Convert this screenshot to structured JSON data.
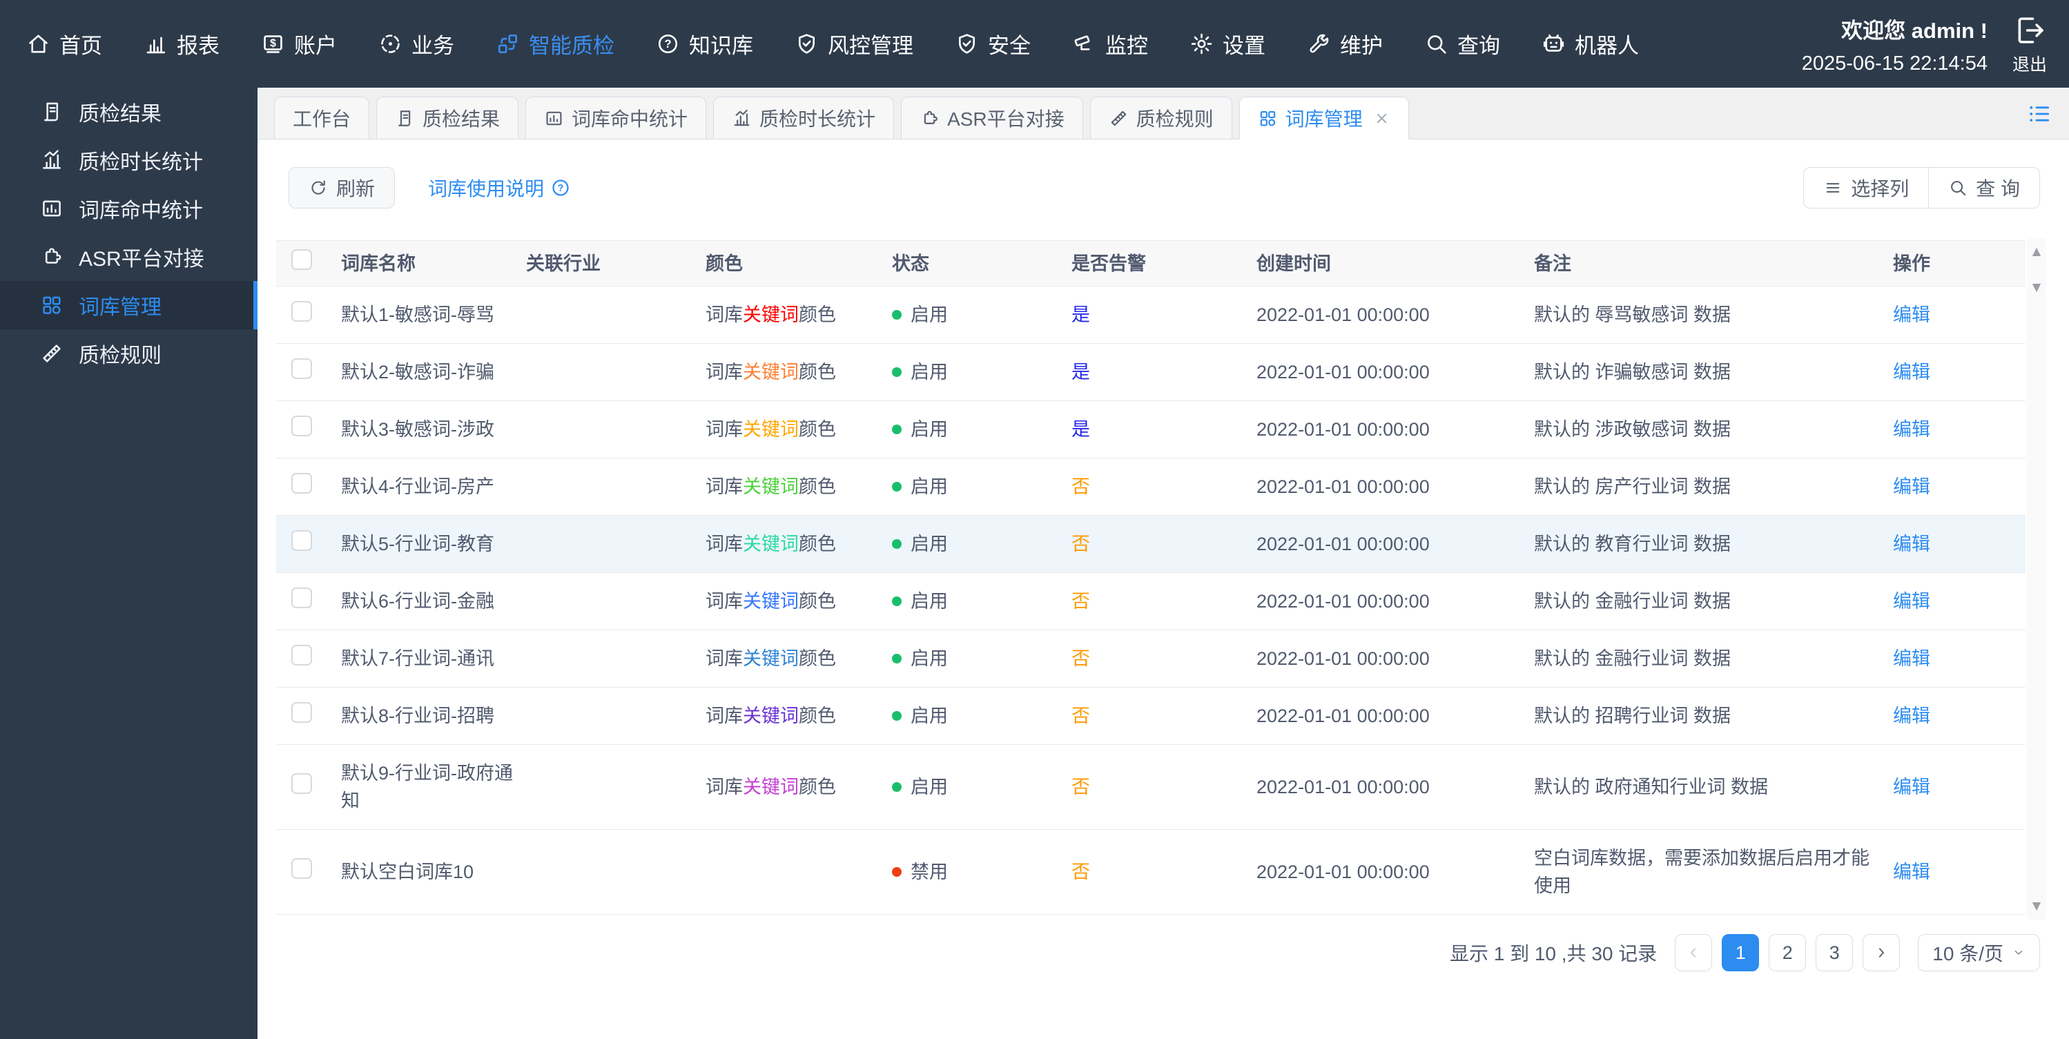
{
  "topnav": {
    "items": [
      {
        "label": "首页",
        "icon": "home"
      },
      {
        "label": "报表",
        "icon": "report"
      },
      {
        "label": "账户",
        "icon": "account"
      },
      {
        "label": "业务",
        "icon": "business"
      },
      {
        "label": "智能质检",
        "icon": "quality-check"
      },
      {
        "label": "知识库",
        "icon": "knowledge"
      },
      {
        "label": "风控管理",
        "icon": "risk-control"
      },
      {
        "label": "安全",
        "icon": "security"
      },
      {
        "label": "监控",
        "icon": "monitor"
      },
      {
        "label": "设置",
        "icon": "settings"
      },
      {
        "label": "维护",
        "icon": "maintenance"
      },
      {
        "label": "查询",
        "icon": "query"
      },
      {
        "label": "机器人",
        "icon": "robot"
      }
    ],
    "welcome": "欢迎您 admin !",
    "datetime": "2025-06-15 22:14:54",
    "logout": "退出"
  },
  "sidebar": {
    "items": [
      {
        "label": "质检结果"
      },
      {
        "label": "质检时长统计"
      },
      {
        "label": "词库命中统计"
      },
      {
        "label": "ASR平台对接"
      },
      {
        "label": "词库管理"
      },
      {
        "label": "质检规则"
      }
    ]
  },
  "tabs": {
    "items": [
      {
        "label": "工作台"
      },
      {
        "label": "质检结果"
      },
      {
        "label": "词库命中统计"
      },
      {
        "label": "质检时长统计"
      },
      {
        "label": "ASR平台对接"
      },
      {
        "label": "质检规则"
      },
      {
        "label": "词库管理"
      }
    ]
  },
  "toolbar": {
    "refresh": "刷新",
    "help": "词库使用说明",
    "columns": "选择列",
    "query": "查 询"
  },
  "table": {
    "headers": [
      "词库名称",
      "关联行业",
      "颜色",
      "状态",
      "是否告警",
      "创建时间",
      "备注",
      "操作"
    ],
    "rows": [
      {
        "name": "默认1-敏感词-辱骂",
        "industry": "",
        "color_pre": "词库",
        "color_word": "关键词",
        "color_post": "颜色",
        "color_hex": "#ff0000",
        "status": "启用",
        "status_color": "#19be6b",
        "alarm": "是",
        "alarm_color": "#2727ee",
        "created": "2022-01-01 00:00:00",
        "remark": "默认的 辱骂敏感词 数据",
        "action": "编辑"
      },
      {
        "name": "默认2-敏感词-诈骗",
        "industry": "",
        "color_pre": "词库",
        "color_word": "关键词",
        "color_post": "颜色",
        "color_hex": "#ff7f33",
        "status": "启用",
        "status_color": "#19be6b",
        "alarm": "是",
        "alarm_color": "#2727ee",
        "created": "2022-01-01 00:00:00",
        "remark": "默认的 诈骗敏感词 数据",
        "action": "编辑"
      },
      {
        "name": "默认3-敏感词-涉政",
        "industry": "",
        "color_pre": "词库",
        "color_word": "关键词",
        "color_post": "颜色",
        "color_hex": "#ffa500",
        "status": "启用",
        "status_color": "#19be6b",
        "alarm": "是",
        "alarm_color": "#2727ee",
        "created": "2022-01-01 00:00:00",
        "remark": "默认的 涉政敏感词 数据",
        "action": "编辑"
      },
      {
        "name": "默认4-行业词-房产",
        "industry": "",
        "color_pre": "词库",
        "color_word": "关键词",
        "color_post": "颜色",
        "color_hex": "#4bd139",
        "status": "启用",
        "status_color": "#19be6b",
        "alarm": "否",
        "alarm_color": "#ff9900",
        "created": "2022-01-01 00:00:00",
        "remark": "默认的 房产行业词 数据",
        "action": "编辑"
      },
      {
        "name": "默认5-行业词-教育",
        "industry": "",
        "color_pre": "词库",
        "color_word": "关键词",
        "color_post": "颜色",
        "color_hex": "#2bd9a5",
        "status": "启用",
        "status_color": "#19be6b",
        "alarm": "否",
        "alarm_color": "#ff9900",
        "created": "2022-01-01 00:00:00",
        "remark": "默认的 教育行业词 数据",
        "action": "编辑"
      },
      {
        "name": "默认6-行业词-金融",
        "industry": "",
        "color_pre": "词库",
        "color_word": "关键词",
        "color_post": "颜色",
        "color_hex": "#3377fc",
        "status": "启用",
        "status_color": "#19be6b",
        "alarm": "否",
        "alarm_color": "#ff9900",
        "created": "2022-01-01 00:00:00",
        "remark": "默认的 金融行业词 数据",
        "action": "编辑"
      },
      {
        "name": "默认7-行业词-通讯",
        "industry": "",
        "color_pre": "词库",
        "color_word": "关键词",
        "color_post": "颜色",
        "color_hex": "#2e82d4",
        "status": "启用",
        "status_color": "#19be6b",
        "alarm": "否",
        "alarm_color": "#ff9900",
        "created": "2022-01-01 00:00:00",
        "remark": "默认的 金融行业词 数据",
        "action": "编辑"
      },
      {
        "name": "默认8-行业词-招聘",
        "industry": "",
        "color_pre": "词库",
        "color_word": "关键词",
        "color_post": "颜色",
        "color_hex": "#6a32d3",
        "status": "启用",
        "status_color": "#19be6b",
        "alarm": "否",
        "alarm_color": "#ff9900",
        "created": "2022-01-01 00:00:00",
        "remark": "默认的 招聘行业词 数据",
        "action": "编辑"
      },
      {
        "name": "默认9-行业词-政府通知",
        "industry": "",
        "color_pre": "词库",
        "color_word": "关键词",
        "color_post": "颜色",
        "color_hex": "#c341d3",
        "status": "启用",
        "status_color": "#19be6b",
        "alarm": "否",
        "alarm_color": "#ff9900",
        "created": "2022-01-01 00:00:00",
        "remark": "默认的 政府通知行业词 数据",
        "action": "编辑"
      },
      {
        "name": "默认空白词库10",
        "industry": "",
        "color_pre": "",
        "color_word": "",
        "color_post": "",
        "color_hex": "#515a6e",
        "status": "禁用",
        "status_color": "#ed3f14",
        "alarm": "否",
        "alarm_color": "#ff9900",
        "created": "2022-01-01 00:00:00",
        "remark": "空白词库数据，需要添加数据后启用才能使用",
        "action": "编辑"
      }
    ]
  },
  "pagination": {
    "summary": "显示 1 到 10 ,共 30 记录",
    "pages": [
      "1",
      "2",
      "3"
    ],
    "active_page": "1",
    "page_size": "10 条/页"
  },
  "colors": {
    "accent": "#2d8cf0",
    "topbar_bg": "#2d3a4a",
    "status_on": "#19be6b",
    "status_off": "#ed3f14",
    "alarm_yes": "#2727ee",
    "alarm_no": "#ff9900",
    "row_highlight": "#eef5fb"
  }
}
